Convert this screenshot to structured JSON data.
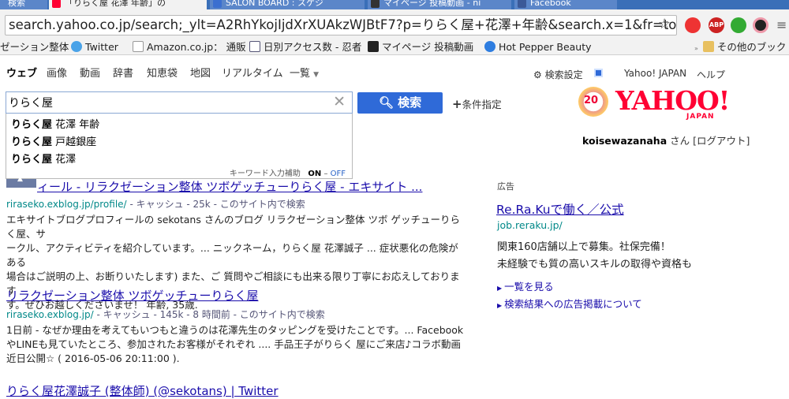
{
  "browser": {
    "tabs": [
      {
        "label": "検索"
      },
      {
        "label": "「りらく屋 花澤 年齢」の"
      },
      {
        "label": "SALON BOARD : スケジ"
      },
      {
        "label": "マイページ 投稿動画 - ni"
      },
      {
        "label": "Facebook"
      }
    ],
    "url": "search.yahoo.co.jp/search;_ylt=A2RhYkojIjdXrXUAkzWJBtF7?p=りらく屋+花澤+年齢&search.x=1&fr=to",
    "bookmarks": [
      {
        "label": "ゼーション整体"
      },
      {
        "label": "Twitter"
      },
      {
        "label": "Amazon.co.jp： 通販"
      },
      {
        "label": "日別アクセス数 - 忍者"
      },
      {
        "label": "マイページ 投稿動画"
      },
      {
        "label": "Hot Pepper Beauty"
      },
      {
        "label": "その他のブック"
      }
    ],
    "ext_icons": {
      "adblock": "ABP"
    },
    "colors": {
      "tab_bg": "#3a6fb8",
      "toolbar": "#f2f2f2"
    }
  },
  "yahoo": {
    "verticals": [
      "ウェブ",
      "画像",
      "動画",
      "辞書",
      "知恵袋",
      "地図",
      "リアルタイム",
      "一覧"
    ],
    "active_vertical": "ウェブ",
    "header_links": {
      "settings": "検索設定",
      "home": "Yahoo! JAPAN",
      "help": "ヘルプ"
    },
    "search": {
      "value": "りらく屋",
      "button": "検索",
      "conditions": "条件指定"
    },
    "suggestions": [
      {
        "bold": "りらく屋",
        "rest": " 花澤 年齢"
      },
      {
        "bold": "りらく屋",
        "rest": " 戸越銀座"
      },
      {
        "bold": "りらく屋",
        "rest": " 花澤"
      }
    ],
    "suggest_footer": {
      "label": "キーワード入力補助",
      "on": "ON",
      "sep": " – ",
      "off": "OFF"
    },
    "logo": {
      "text": "YAHOO!",
      "sub": "JAPAN",
      "badge": "20"
    },
    "user": {
      "name": "koisewazanaha",
      "suffix": "さん",
      "logout": "[ログアウト]"
    },
    "brand_color": "#ff0033"
  },
  "results": [
    {
      "title": "ィール - リラクゼーション整体 ツボゲッチューりらく屋 - エキサイト ...",
      "url": "riraseko.exblog.jp/profile/",
      "meta": "- キャッシュ - 25k - このサイト内で検索",
      "snippet": [
        "エキサイトブログプロフィールの sekotans さんのブログ リラクゼーション整体 ツボ ゲッチューりらく屋、サ",
        "ークル、アクティビティを紹介しています。... ニックネーム，りらく屋 花澤誠子 ... 症状悪化の危険がある",
        "場合はご説明の上、お断りいたします) また、ご 質問やご相談にも出来る限り丁寧にお応えしております",
        "す。ぜひお越しくださいませ！ 年齢, 35歳."
      ]
    },
    {
      "title": "リラクゼーション整体 ツボゲッチューりらく屋",
      "url": "riraseko.exblog.jp/",
      "meta": "- キャッシュ - 145k - 8 時間前 - このサイト内で検索",
      "snippet": [
        "1日前 - なぜか理由を考えてもいつもと違うのは花澤先生のタッピングを受けたことです。... Facebook",
        "やLINEも見ていたところ、参加されたお客様がそれぞれ .... 手品王子がりらく 屋にご来店♪コラボ動画",
        "近日公開☆ ( 2016-05-06 20:11:00 )."
      ]
    },
    {
      "title": "りらく屋花澤誠子 (整体師) (@sekotans) | Twitter"
    }
  ],
  "ads": {
    "label": "広告",
    "title": "Re.Ra.Kuで働く／公式",
    "url": "job.reraku.jp/",
    "lines": [
      "関東160店舗以上で募集。社保完備！",
      "未経験でも質の高いスキルの取得や資格も"
    ],
    "links": [
      "一覧を見る",
      "検索結果への広告掲載について"
    ]
  }
}
